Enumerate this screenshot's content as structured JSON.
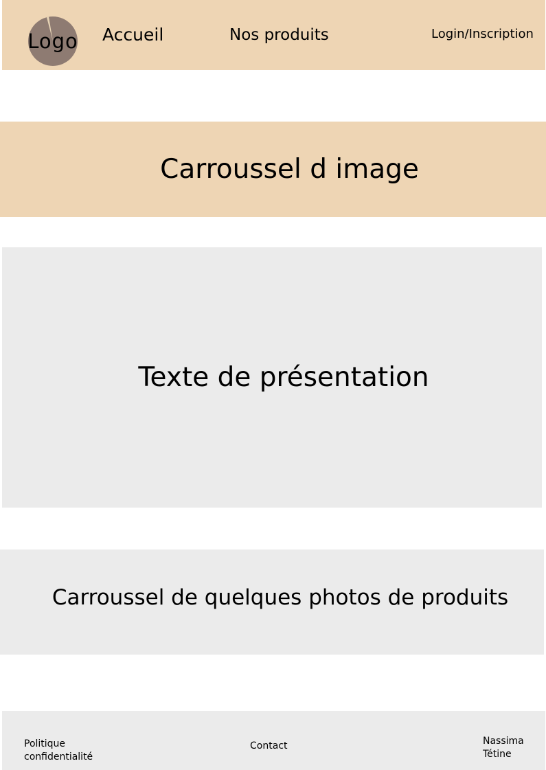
{
  "header": {
    "logo_text": "Logo",
    "nav": {
      "accueil": "Accueil",
      "produits": "Nos produits",
      "login": "Login/Inscription"
    }
  },
  "main": {
    "carousel_top": "Carroussel d image",
    "presentation": "Texte de présentation",
    "carousel_products": "Carroussel de quelques photos de produits"
  },
  "footer": {
    "politique": [
      "Politique",
      "confidentialité"
    ],
    "contact": "Contact",
    "author": [
      "Nassima",
      "Tétine"
    ]
  },
  "colors": {
    "header_bg": "#eed5b4",
    "section_bg": "#ebebeb",
    "logo_circle": "#8e7b72",
    "logo_wedge": "#e6d3b5"
  }
}
